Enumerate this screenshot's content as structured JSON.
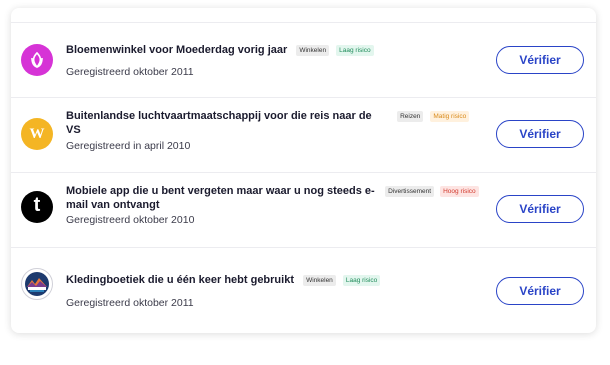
{
  "accounts": [
    {
      "title": "Bloemenwinkel voor Moederdag vorig jaar",
      "category": "Winkelen",
      "risk": "Laag risico",
      "registered": "Geregistreerd oktober 2011",
      "icon": "flower-icon",
      "icon_color": "#d633d6",
      "risk_color": "#1f8c5a"
    },
    {
      "title": "Buitenlandse luchtvaartmaatschappij voor die reis naar de VS",
      "category": "Reizen",
      "risk": "Matig risico",
      "registered": "Geregistreerd in april 2010",
      "icon": "w-logo-icon",
      "icon_color": "#f4b524",
      "icon_letter": "W",
      "risk_color": "#d98b1c"
    },
    {
      "title": "Mobiele app die u bent vergeten maar waar u nog steeds e-mail van ontvangt",
      "category": "Divertissement",
      "risk": "Hoog risico",
      "registered": "Geregistreerd oktober  2010",
      "icon": "t-logo-icon",
      "icon_color": "#000000",
      "icon_letter": "t",
      "risk_color": "#d23a2e"
    },
    {
      "title": "Kledingboetiek die u één keer hebt gebruikt",
      "category": "Winkelen",
      "risk": "Laag risico",
      "registered": "Geregistreerd oktober 2011",
      "icon": "patagonia-logo-icon",
      "icon_color": "#1d3a6e",
      "risk_color": "#1f8c5a"
    }
  ],
  "verify_label": "Vérifier",
  "accent_color": "#2a44c7"
}
